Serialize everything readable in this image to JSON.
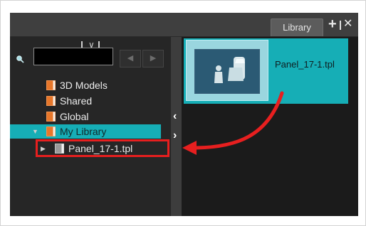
{
  "panel": {
    "tab_label": "Library",
    "add_icon": "plus-icon",
    "close_icon": "close-icon"
  },
  "sidebar": {
    "search_icon": "magnifier-icon",
    "search_value": "",
    "back_icon": "arrow-left-icon",
    "forward_icon": "arrow-right-icon",
    "items": [
      {
        "label": "3D Models",
        "icon": "book-icon"
      },
      {
        "label": "Shared",
        "icon": "book-icon"
      },
      {
        "label": "Global",
        "icon": "book-icon"
      },
      {
        "label": "My Library",
        "icon": "book-icon",
        "expanded": true,
        "selected": true
      },
      {
        "label": "Panel_17-1.tpl",
        "icon": "book-icon",
        "highlighted": true
      }
    ]
  },
  "splitter": {
    "collapse_left_icon": "chevron-left-icon",
    "collapse_right_icon": "chevron-right-icon"
  },
  "content": {
    "items": [
      {
        "label": "Panel_17-1.tpl",
        "thumbnail_icon": "template-thumbnail"
      }
    ]
  },
  "annotation": {
    "box_color": "#e71f1f",
    "arrow_color": "#e71f1f"
  },
  "colors": {
    "selection": "#16aeb6",
    "folder_orange": "#e8772a"
  }
}
